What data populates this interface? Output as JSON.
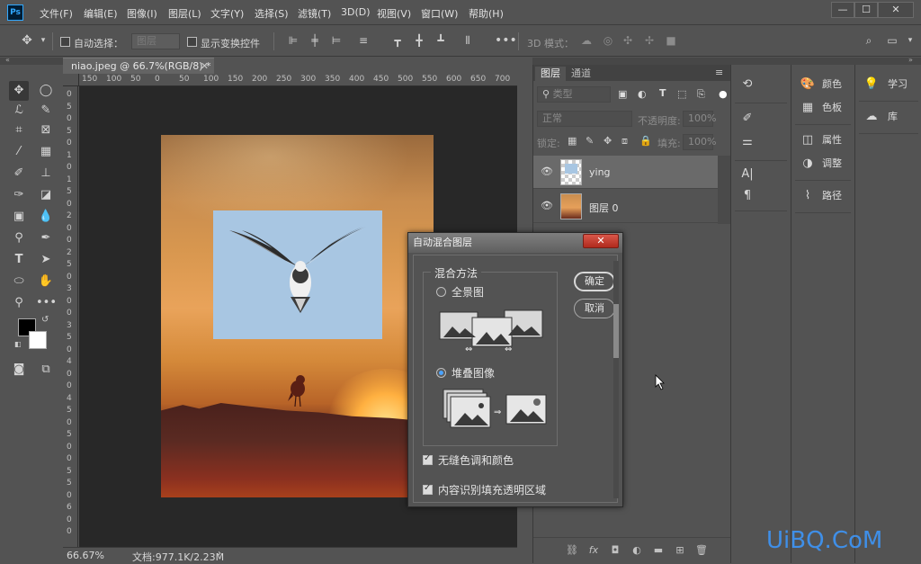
{
  "app": {
    "logo": "Ps"
  },
  "menu": [
    "文件(F)",
    "编辑(E)",
    "图像(I)",
    "图层(L)",
    "文字(Y)",
    "选择(S)",
    "滤镜(T)",
    "3D(D)",
    "视图(V)",
    "窗口(W)",
    "帮助(H)"
  ],
  "window_controls": {
    "minimize": "—",
    "maximize": "☐",
    "close": "✕"
  },
  "options": {
    "auto_select_label": "自动选择：",
    "auto_select_value": "图层",
    "show_transform_label": "显示变换控件",
    "mode_3d_label": "3D 模式："
  },
  "document": {
    "tab_title": "niao.jpeg @ 66.7%(RGB/8) *",
    "zoom": "66.67%",
    "doc_size": "文档:977.1K/2.23M"
  },
  "ruler": {
    "h_labels": [
      "150",
      "100",
      "50",
      "0",
      "50",
      "100",
      "150",
      "200",
      "250",
      "300",
      "350",
      "400",
      "450",
      "500",
      "550",
      "600",
      "650",
      "700"
    ],
    "v_labels": [
      "0",
      "5",
      "0",
      "5",
      "0",
      "1",
      "0",
      "1",
      "5",
      "0",
      "2",
      "0",
      "0",
      "2",
      "5",
      "0",
      "3",
      "0",
      "0",
      "3",
      "5",
      "0",
      "4",
      "0",
      "0",
      "4",
      "5",
      "0",
      "5",
      "0",
      "0",
      "5",
      "5",
      "0",
      "6",
      "0",
      "0"
    ]
  },
  "layers_panel": {
    "tabs": [
      "图层",
      "通道"
    ],
    "filter_placeholder": "类型",
    "blend_mode": "正常",
    "opacity_label": "不透明度:",
    "opacity_value": "100%",
    "lock_label": "锁定:",
    "fill_label": "填充:",
    "fill_value": "100%",
    "layers": [
      {
        "name": "ying",
        "visible": true
      },
      {
        "name": "图层 0",
        "visible": true
      }
    ]
  },
  "right_columns": {
    "col2": [],
    "col3": [
      "颜色",
      "色板",
      "属性",
      "调整",
      "路径"
    ],
    "col4": [
      "学习",
      "库"
    ]
  },
  "dialog": {
    "title": "自动混合图层",
    "close": "✕",
    "group_title": "混合方法",
    "option_panorama": "全景图",
    "option_stack": "堆叠图像",
    "selected": "stack",
    "ok": "确定",
    "cancel": "取消",
    "check_seamless": "无缝色调和颜色",
    "check_seamless_on": true,
    "check_content_aware": "内容识别填充透明区域",
    "check_content_aware_on": true
  },
  "watermark": "UiBQ.CoM",
  "colors": {
    "accent": "#31a8ff",
    "close_red": "#c83a2c",
    "panel_bg": "#535353",
    "canvas_bg": "#282828"
  }
}
